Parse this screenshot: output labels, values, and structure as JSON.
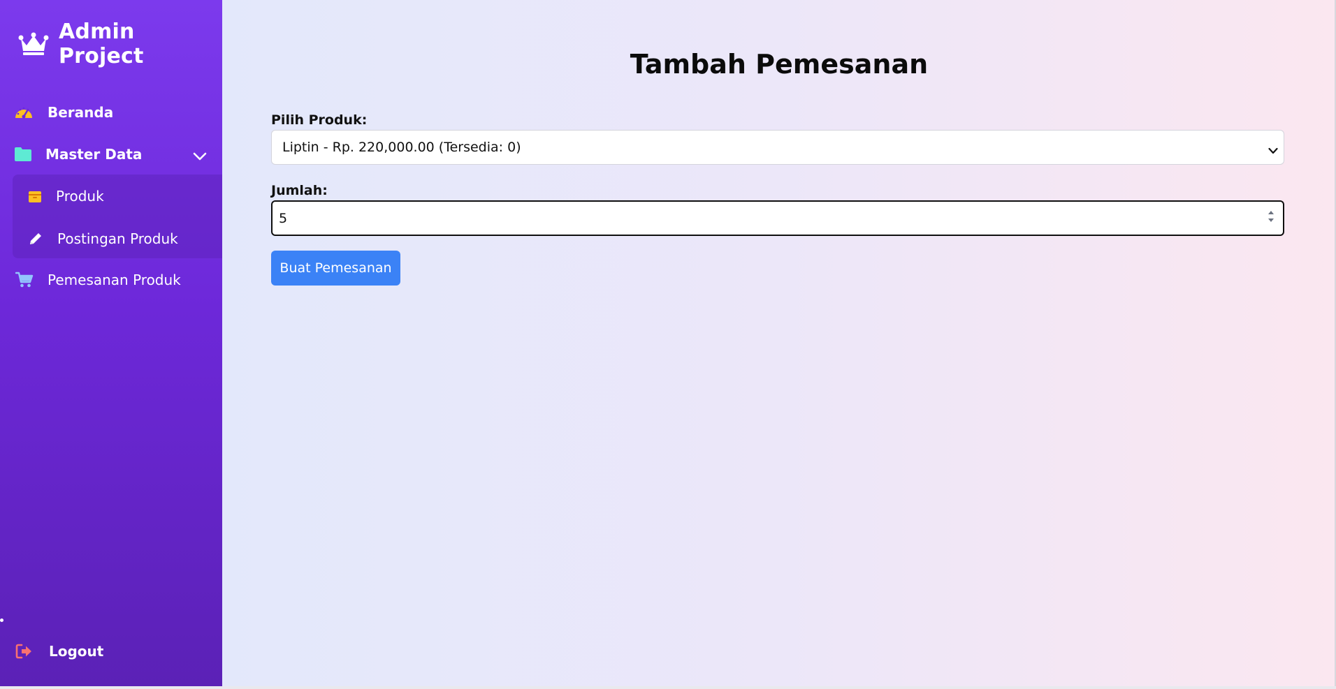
{
  "sidebar": {
    "brand": {
      "title": "Admin Project",
      "icon": "crown-icon"
    },
    "items": [
      {
        "label": "Beranda",
        "icon": "gauge-icon",
        "icon_color": "#fbbf24"
      },
      {
        "label": "Master Data",
        "icon": "folder-icon",
        "icon_color": "#5eead4",
        "expanded": true,
        "children": [
          {
            "label": "Produk",
            "icon": "box-icon",
            "icon_color": "#fbbf24"
          },
          {
            "label": "Postingan Produk",
            "icon": "pencil-icon",
            "icon_color": "#ffffff"
          }
        ]
      },
      {
        "label": "Pemesanan Produk",
        "icon": "cart-icon",
        "icon_color": "#93c5fd"
      }
    ],
    "logout": {
      "label": "Logout",
      "icon": "logout-icon",
      "icon_color": "#f87171"
    }
  },
  "main": {
    "title": "Tambah Pemesanan",
    "form": {
      "product_label": "Pilih Produk:",
      "product_selected": "Liptin - Rp. 220,000.00 (Tersedia: 0)",
      "quantity_label": "Jumlah:",
      "quantity_value": "5",
      "submit_label": "Buat Pemesanan"
    }
  },
  "colors": {
    "sidebar_top": "#7c3aed",
    "sidebar_bottom": "#5b21b6",
    "button": "#3b82f6",
    "background_left": "#e3e8fb",
    "background_right": "#fbe7f0"
  }
}
